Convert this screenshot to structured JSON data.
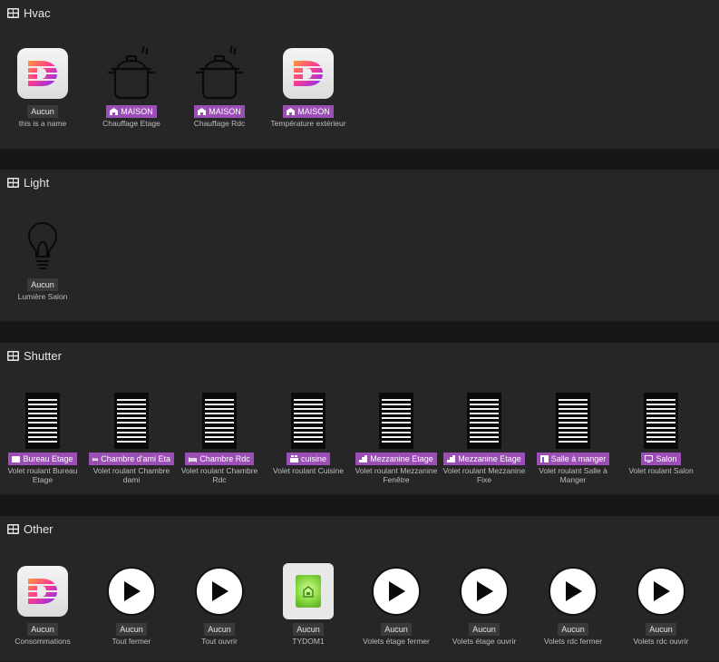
{
  "colors": {
    "background": "#171717",
    "panel": "#262626",
    "room_badge": "#9b4fb5",
    "none_badge": "#3a3a3a"
  },
  "sections": {
    "hvac": {
      "title": "Hvac",
      "items": [
        {
          "icon": "deltadore-app-icon",
          "badge": "Aucun",
          "name": "this is a name"
        },
        {
          "icon": "pressure-cooker-icon",
          "badge": "MAISON",
          "name": "Chauffage Etage"
        },
        {
          "icon": "pressure-cooker-icon",
          "badge": "MAISON",
          "name": "Chauffage Rdc"
        },
        {
          "icon": "deltadore-app-icon",
          "badge": "MAISON",
          "name": "Température extérieur"
        }
      ]
    },
    "light": {
      "title": "Light",
      "items": [
        {
          "icon": "light-bulb-icon",
          "badge": "Aucun",
          "name": "Lumière Salon"
        }
      ]
    },
    "shutter": {
      "title": "Shutter",
      "items": [
        {
          "icon": "shutter-icon",
          "badge": "Bureau Etage",
          "badge_icon": "office-icon",
          "name": "Volet roulant Bureau Etage"
        },
        {
          "icon": "shutter-icon",
          "badge": "Chambre d'ami Eta",
          "badge_icon": "bed-icon",
          "name": "Volet roulant Chambre dami"
        },
        {
          "icon": "shutter-icon",
          "badge": "Chambre Rdc",
          "badge_icon": "bed-icon",
          "name": "Volet roulant Chambre Rdc"
        },
        {
          "icon": "shutter-icon",
          "badge": "cuisine",
          "badge_icon": "stove-icon",
          "name": "Volet roulant Cuisine"
        },
        {
          "icon": "shutter-icon",
          "badge": "Mezzanine Etage",
          "badge_icon": "stairs-icon",
          "name": "Volet roulant Mezzanine Fenêtre"
        },
        {
          "icon": "shutter-icon",
          "badge": "Mezzanine Etage",
          "badge_icon": "stairs-icon",
          "name": "Volet roulant Mezzanine Fixe"
        },
        {
          "icon": "shutter-icon",
          "badge": "Salle à manger",
          "badge_icon": "dining-icon",
          "name": "Volet roulant Salle à Manger"
        },
        {
          "icon": "shutter-icon",
          "badge": "Salon",
          "badge_icon": "tv-icon",
          "name": "Volet roulant Salon"
        }
      ]
    },
    "other": {
      "title": "Other",
      "items": [
        {
          "icon": "deltadore-app-icon",
          "badge": "Aucun",
          "name": "Consommations"
        },
        {
          "icon": "play-icon",
          "badge": "Aucun",
          "name": "Tout fermer"
        },
        {
          "icon": "play-icon",
          "badge": "Aucun",
          "name": "Tout ouvrir"
        },
        {
          "icon": "tydom-device-icon",
          "badge": "Aucun",
          "name": "TYDOM1"
        },
        {
          "icon": "play-icon",
          "badge": "Aucun",
          "name": "Volets étage fermer"
        },
        {
          "icon": "play-icon",
          "badge": "Aucun",
          "name": "Volets étage ouvrir"
        },
        {
          "icon": "play-icon",
          "badge": "Aucun",
          "name": "Volets rdc fermer"
        },
        {
          "icon": "play-icon",
          "badge": "Aucun",
          "name": "Volets rdc ouvrir"
        }
      ]
    }
  }
}
